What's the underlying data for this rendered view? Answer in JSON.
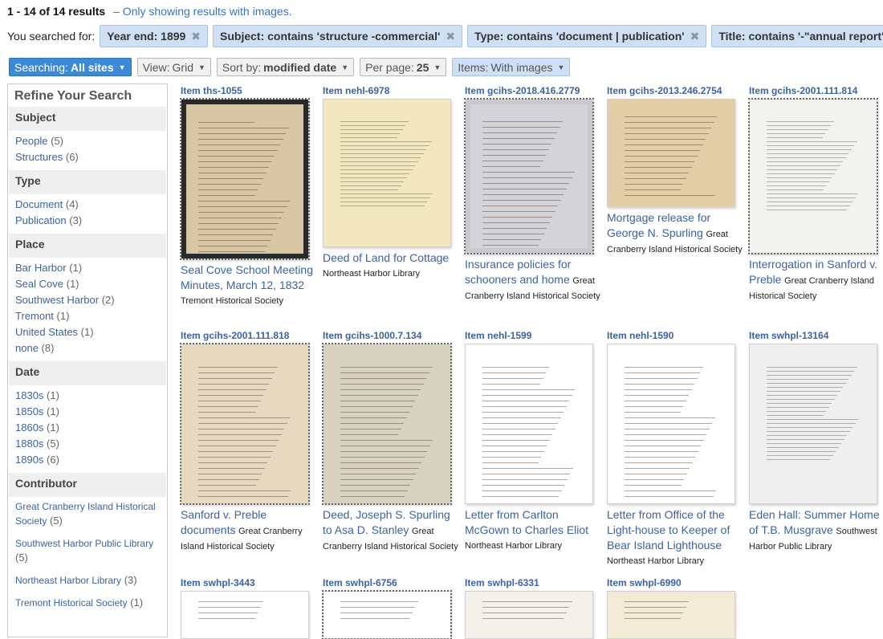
{
  "header": {
    "results_count": "1 - 14 of 14 results",
    "results_note": "– Only showing results with images.",
    "searched_label": "You searched for:",
    "filters": [
      {
        "label": "Year end: 1899"
      },
      {
        "label": "Subject: contains 'structure -commercial'"
      },
      {
        "label": "Type: contains 'document | publication'"
      },
      {
        "label": "Title: contains '-\"annual report\"'"
      }
    ],
    "remove_glyph": "✖"
  },
  "toolbar": {
    "searching_label": "Searching:",
    "searching_value": "All sites",
    "view_label": "View:",
    "view_value": "Grid",
    "sort_label": "Sort by:",
    "sort_value": "modified date",
    "perpage_label": "Per page:",
    "perpage_value": "25",
    "items_label": "Items:",
    "items_value": "With images",
    "caret": "▼"
  },
  "sidebar": {
    "title": "Refine Your Search",
    "facets": [
      {
        "heading": "Subject",
        "items": [
          {
            "label": "People",
            "count": "(5)"
          },
          {
            "label": "Structures",
            "count": "(6)"
          }
        ]
      },
      {
        "heading": "Type",
        "items": [
          {
            "label": "Document",
            "count": "(4)"
          },
          {
            "label": "Publication",
            "count": "(3)"
          }
        ]
      },
      {
        "heading": "Place",
        "items": [
          {
            "label": "Bar Harbor",
            "count": "(1)"
          },
          {
            "label": "Seal Cove",
            "count": "(1)"
          },
          {
            "label": "Southwest Harbor",
            "count": "(2)"
          },
          {
            "label": "Tremont",
            "count": "(1)"
          },
          {
            "label": "United States",
            "count": "(1)"
          },
          {
            "label": "none",
            "count": "(8)"
          }
        ]
      },
      {
        "heading": "Date",
        "items": [
          {
            "label": "1830s",
            "count": "(1)"
          },
          {
            "label": "1850s",
            "count": "(1)"
          },
          {
            "label": "1860s",
            "count": "(1)"
          },
          {
            "label": "1880s",
            "count": "(5)"
          },
          {
            "label": "1890s",
            "count": "(6)"
          }
        ]
      }
    ],
    "contributor": {
      "heading": "Contributor",
      "items": [
        {
          "label": "Great Cranberry Island Historical Society",
          "count": "(5)"
        },
        {
          "label": "Southwest Harbor Public Library",
          "count": "(5)"
        },
        {
          "label": "Northeast Harbor Library",
          "count": "(3)"
        },
        {
          "label": "Tremont Historical Society",
          "count": "(1)"
        }
      ]
    }
  },
  "items": [
    {
      "id": "Item ths-1055",
      "title": "Seal Cove School Meeting Minutes, March 12, 1832",
      "source": "Tremont Historical Society",
      "thumb_bg": "#2a2a2a",
      "paper": "#d8c7a4"
    },
    {
      "id": "Item nehl-6978",
      "title": "Deed of Land for Cottage",
      "source": "Northeast Harbor Library",
      "thumb_bg": "#f2e7bf",
      "paper": "#f2e7bf"
    },
    {
      "id": "Item gcihs-2018.416.2779",
      "title": "Insurance policies for schooners and home",
      "source": "Great Cranberry Island Historical Society",
      "thumb_bg": "#c9c9cf",
      "paper": "#d4d4d8"
    },
    {
      "id": "Item gcihs-2013.246.2754",
      "title": "Mortgage release for George N. Spurling",
      "source": "Great Cranberry Island Historical Society",
      "thumb_bg": "#e2cda6",
      "paper": "#e2cda6"
    },
    {
      "id": "Item gcihs-2001.111.814",
      "title": "Interrogation in Sanford v. Preble",
      "source": "Great Cranberry Island Historical Society",
      "thumb_bg": "#f2f2ee",
      "paper": "#f2f2ee"
    },
    {
      "id": "Item gcihs-2001.111.818",
      "title": "Sanford v. Preble documents",
      "source": "Great Cranberry Island Historical Society",
      "thumb_bg": "#e6d9bf",
      "paper": "#e6d9bf"
    },
    {
      "id": "Item gcihs-1000.7.134",
      "title": "Deed, Joseph S. Spurling to Asa D. Stanley",
      "source": "Great Cranberry Island Historical Society",
      "thumb_bg": "#d7d2c0",
      "paper": "#d7d2c0"
    },
    {
      "id": "Item nehl-1599",
      "title": "Letter from Carlton McGown to Charles Eliot",
      "source": "Northeast Harbor Library",
      "thumb_bg": "#ffffff",
      "paper": "#ffffff"
    },
    {
      "id": "Item nehl-1590",
      "title": "Letter from Office of the Light-house to Keeper of Bear Island Lighthouse",
      "source": "Northeast Harbor Library",
      "thumb_bg": "#ffffff",
      "paper": "#ffffff"
    },
    {
      "id": "Item swhpl-13164",
      "title": "Eden Hall: Summer Home of T.B. Musgrave",
      "source": "Southwest Harbor Public Library",
      "thumb_bg": "#efefef",
      "paper": "#efefef"
    },
    {
      "id": "Item swhpl-3443",
      "title": "",
      "source": "",
      "thumb_bg": "#ffffff",
      "paper": "#ffffff"
    },
    {
      "id": "Item swhpl-6756",
      "title": "",
      "source": "",
      "thumb_bg": "#ffffff",
      "paper": "#ffffff"
    },
    {
      "id": "Item swhpl-6331",
      "title": "",
      "source": "",
      "thumb_bg": "#f4f1ea",
      "paper": "#f4f1ea"
    },
    {
      "id": "Item swhpl-6990",
      "title": "",
      "source": "",
      "thumb_bg": "#f3ead8",
      "paper": "#f3ead8"
    }
  ]
}
